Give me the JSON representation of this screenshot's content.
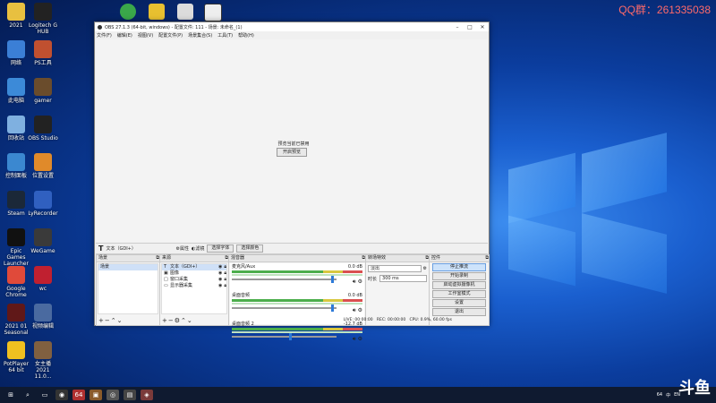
{
  "watermark": "QQ群：261335038",
  "desktop_icons": [
    {
      "label": "2021",
      "color": "#e8c040"
    },
    {
      "label": "Logitech G HUB",
      "color": "#222222"
    },
    {
      "label": "网络",
      "color": "#3b7fd6"
    },
    {
      "label": "PS工具",
      "color": "#c05030"
    },
    {
      "label": "此电脑",
      "color": "#3c8ad8"
    },
    {
      "label": "gamer",
      "color": "#6a4c2c"
    },
    {
      "label": "回收站",
      "color": "#7fb0e0"
    },
    {
      "label": "OBS Studio",
      "color": "#222222"
    },
    {
      "label": "控制面板",
      "color": "#3b88d0"
    },
    {
      "label": "位置设置",
      "color": "#e08a2a"
    },
    {
      "label": "Steam",
      "color": "#1b2838"
    },
    {
      "label": "LyRecorder",
      "color": "#3060c0"
    },
    {
      "label": "Epic Games Launcher",
      "color": "#111111"
    },
    {
      "label": "WeGame",
      "color": "#3a3a3a"
    },
    {
      "label": "Google Chrome",
      "color": "#e04a3a"
    },
    {
      "label": "wc",
      "color": "#c02030"
    },
    {
      "label": "2021 01 Seasonal",
      "color": "#601818"
    },
    {
      "label": "视频编辑",
      "color": "#4a6aa0"
    },
    {
      "label": "PotPlayer 64 bit",
      "color": "#f0c020"
    },
    {
      "label": "女主播 2021 11.0...",
      "color": "#806040"
    }
  ],
  "obs": {
    "title": "OBS 27.1.3 (64-bit, windows) - 配置文件: 111 - 场景: 未命名_(1)",
    "menu": [
      "文件(F)",
      "编辑(E)",
      "视图(V)",
      "配置文件(P)",
      "场景集合(S)",
      "工具(T)",
      "帮助(H)"
    ],
    "preview_msg": "预览当前已禁用",
    "preview_btn": "开启预览",
    "source_label": "文本（GDI+）",
    "props_btn": "属性",
    "filters_btn": "滤镜",
    "select_font_btn": "选择字体",
    "select_color_btn": "选择颜色",
    "scenes_title": "场景",
    "scenes": [
      "场景"
    ],
    "sources_title": "来源",
    "sources": [
      {
        "name": "文本（GDI+）",
        "icon": "T"
      },
      {
        "name": "图像",
        "icon": "▣"
      },
      {
        "name": "窗口采集",
        "icon": "□"
      },
      {
        "name": "显示器采集",
        "icon": "▭"
      }
    ],
    "mixer_title": "混音器",
    "mixer": [
      {
        "name": "麦克风/Aux",
        "db": "0.0 dB",
        "vol": 0.95
      },
      {
        "name": "桌面音频",
        "db": "0.0 dB",
        "vol": 0.95
      },
      {
        "name": "桌面音频 2",
        "db": "-12.7 dB",
        "vol": 0.55
      }
    ],
    "transition_title": "转场特效",
    "transition_value": "淡出",
    "duration_label": "时长",
    "duration_value": "300 ms",
    "controls_title": "控件",
    "controls": [
      "停止推流",
      "开始录制",
      "启动虚拟摄像机",
      "工作室模式",
      "设置",
      "退出"
    ],
    "status": {
      "live": "LIVE: 00:00:00",
      "rec": "REC: 00:00:00",
      "cpu": "CPU: 0.9%, 60.00 fps"
    }
  },
  "taskbar": {
    "items": [
      "⊞",
      "⌕",
      "▭",
      "◉",
      "64",
      "▣",
      "◎",
      "▤",
      "◈"
    ],
    "tray": [
      "64",
      "中",
      "EN"
    ],
    "brand": "斗鱼"
  }
}
